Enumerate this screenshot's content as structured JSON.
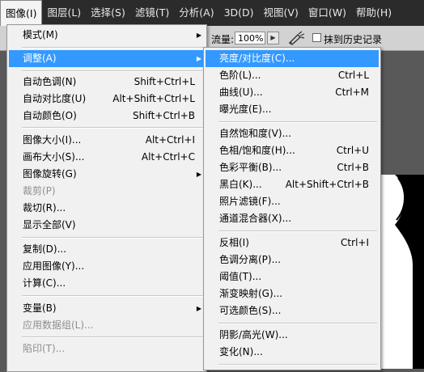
{
  "menubar": {
    "items": [
      {
        "label": "图像(I)",
        "active": true
      },
      {
        "label": "图层(L)"
      },
      {
        "label": "选择(S)"
      },
      {
        "label": "滤镜(T)"
      },
      {
        "label": "分析(A)"
      },
      {
        "label": "3D(D)"
      },
      {
        "label": "视图(V)"
      },
      {
        "label": "窗口(W)"
      },
      {
        "label": "帮助(H)"
      }
    ]
  },
  "options_bar": {
    "flow_label": "流量:",
    "flow_value": "100%",
    "history_label": "抹到历史记录"
  },
  "image_menu": {
    "items": [
      {
        "label": "模式(M)",
        "submenu": true
      },
      {
        "label": "调整(A)",
        "submenu": true,
        "highlighted": true
      },
      {
        "label": "自动色调(N)",
        "shortcut": "Shift+Ctrl+L"
      },
      {
        "label": "自动对比度(U)",
        "shortcut": "Alt+Shift+Ctrl+L"
      },
      {
        "label": "自动颜色(O)",
        "shortcut": "Shift+Ctrl+B"
      },
      {
        "label": "图像大小(I)...",
        "shortcut": "Alt+Ctrl+I"
      },
      {
        "label": "画布大小(S)...",
        "shortcut": "Alt+Ctrl+C"
      },
      {
        "label": "图像旋转(G)",
        "submenu": true
      },
      {
        "label": "裁剪(P)",
        "disabled": true
      },
      {
        "label": "裁切(R)..."
      },
      {
        "label": "显示全部(V)"
      },
      {
        "label": "复制(D)..."
      },
      {
        "label": "应用图像(Y)..."
      },
      {
        "label": "计算(C)..."
      },
      {
        "label": "变量(B)",
        "submenu": true
      },
      {
        "label": "应用数据组(L)...",
        "disabled": true
      },
      {
        "label": "陷印(T)...",
        "disabled": true
      }
    ]
  },
  "adjust_menu": {
    "items": [
      {
        "label": "亮度/对比度(C)...",
        "highlighted": true
      },
      {
        "label": "色阶(L)...",
        "shortcut": "Ctrl+L"
      },
      {
        "label": "曲线(U)...",
        "shortcut": "Ctrl+M"
      },
      {
        "label": "曝光度(E)..."
      },
      {
        "label": "自然饱和度(V)..."
      },
      {
        "label": "色相/饱和度(H)...",
        "shortcut": "Ctrl+U"
      },
      {
        "label": "色彩平衡(B)...",
        "shortcut": "Ctrl+B"
      },
      {
        "label": "黑白(K)...",
        "shortcut": "Alt+Shift+Ctrl+B"
      },
      {
        "label": "照片滤镜(F)..."
      },
      {
        "label": "通道混合器(X)..."
      },
      {
        "label": "反相(I)",
        "shortcut": "Ctrl+I"
      },
      {
        "label": "色调分离(P)..."
      },
      {
        "label": "阈值(T)..."
      },
      {
        "label": "渐变映射(G)..."
      },
      {
        "label": "可选颜色(S)..."
      },
      {
        "label": "阴影/高光(W)..."
      },
      {
        "label": "变化(N)..."
      }
    ]
  },
  "colors": {
    "highlight": "#3399ff",
    "menu_bg": "#f1f1f1",
    "menubar_bg": "#2b2b2b",
    "disabled_text": "#8e8e8e"
  }
}
